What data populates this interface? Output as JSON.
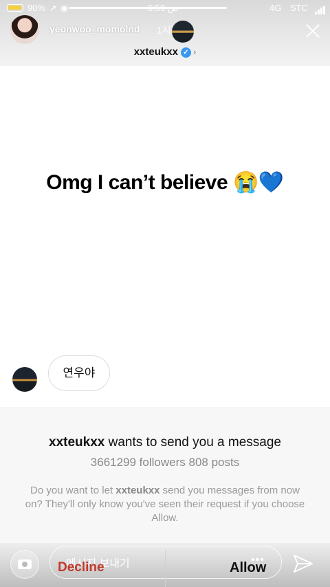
{
  "status_bar": {
    "battery": "90%",
    "time": "6:59 ص",
    "network": "4G",
    "carrier": "STC"
  },
  "story": {
    "username": "yeonwoo_momolnd",
    "time_ago": "1시간",
    "text": "Omg I can’t believe 😭💙",
    "reply_text": "연우야"
  },
  "dm": {
    "name": "xxteukxx",
    "verified": true
  },
  "request": {
    "username": "xxteukxx",
    "title_suffix": " wants to send you a message",
    "stats": "3661299 followers 808 posts",
    "desc_prefix": "Do you want to let ",
    "desc_username": "xxteukxx",
    "desc_suffix": " send you messages from now on? They'll only know you've seen their request if you choose Allow."
  },
  "bottom": {
    "message_placeholder": "메시지 보내기",
    "decline_label": "Decline",
    "allow_label": "Allow",
    "more_label": "•••"
  },
  "colors": {
    "decline": "#c0392b",
    "verified": "#3897f0"
  }
}
